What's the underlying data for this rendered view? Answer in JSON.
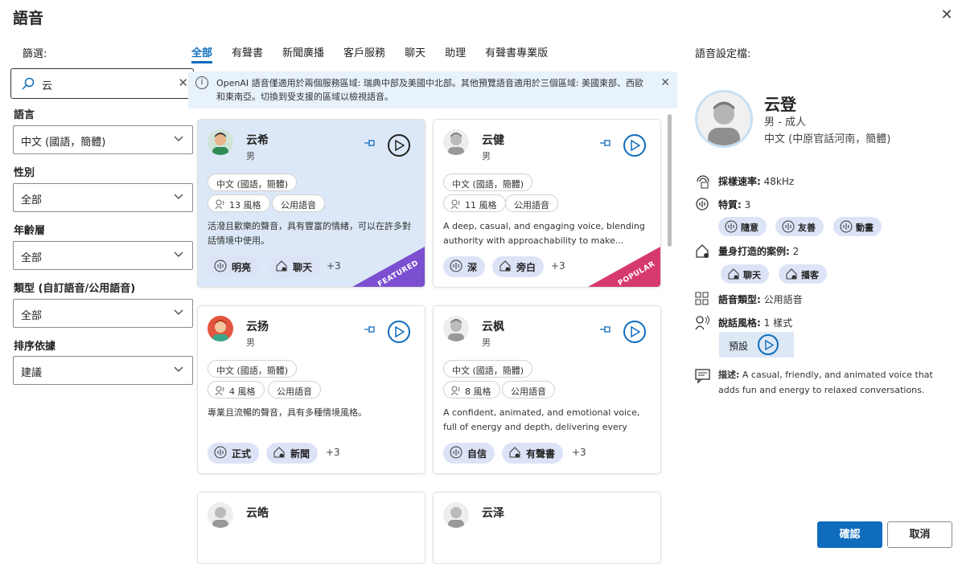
{
  "dialog": {
    "title": "語音"
  },
  "filters": {
    "label": "篩選:",
    "search_value": "云",
    "language": {
      "label": "語言",
      "value": "中文 (國語，簡體)"
    },
    "gender": {
      "label": "性別",
      "value": "全部"
    },
    "age": {
      "label": "年齡層",
      "value": "全部"
    },
    "type": {
      "label": "類型 (自訂語音/公用語音)",
      "value": "全部"
    },
    "sort": {
      "label": "排序依據",
      "value": "建議"
    }
  },
  "tabs": [
    "全部",
    "有聲書",
    "新聞廣播",
    "客戶服務",
    "聊天",
    "助理",
    "有聲書專業版"
  ],
  "banner": {
    "text": "OpenAI 語音僅適用於兩個服務區域: 瑞典中部及美國中北部。其他預覽語音適用於三個區域: 美國東部、西歐和東南亞。切換到受支援的區域以檢視語音。"
  },
  "cards": [
    {
      "name": "云希",
      "gender": "男",
      "lang": "中文 (國語，簡體)",
      "styles": "13 風格",
      "kind": "公用語音",
      "desc": "活潑且歡樂的聲音，具有豐富的情緒，可以在許多對話情境中使用。",
      "tag1": "明亮",
      "tag2": "聊天",
      "more": "+3",
      "ribbon": "FEATURED"
    },
    {
      "name": "云健",
      "gender": "男",
      "lang": "中文 (國語，簡體)",
      "styles": "11 風格",
      "kind": "公用語音",
      "desc": "A deep, casual, and engaging voice, blending authority with approachability to make...",
      "tag1": "深",
      "tag2": "旁白",
      "more": "+3",
      "ribbon": "POPULAR"
    },
    {
      "name": "云扬",
      "gender": "男",
      "lang": "中文 (國語，簡體)",
      "styles": "4 風格",
      "kind": "公用語音",
      "desc": "專業且流暢的聲音，具有多種情境風格。",
      "tag1": "正式",
      "tag2": "新聞",
      "more": "+3"
    },
    {
      "name": "云枫",
      "gender": "男",
      "lang": "中文 (國語，簡體)",
      "styles": "8 風格",
      "kind": "公用語音",
      "desc": "A confident, animated, and emotional voice, full of energy and depth, delivering every message...",
      "tag1": "自信",
      "tag2": "有聲書",
      "more": "+3"
    },
    {
      "name": "云皓"
    },
    {
      "name": "云泽"
    }
  ],
  "profile": {
    "label": "語音設定檔:",
    "name": "云登",
    "sub": "男 - 成人",
    "lang": "中文 (中原官話河南，簡體)",
    "sample_rate_label": "採樣速率:",
    "sample_rate": "48kHz",
    "traits_label": "特質:",
    "traits_count": "3",
    "traits": [
      "隨意",
      "友善",
      "動畫"
    ],
    "cases_label": "量身打造的案例:",
    "cases_count": "2",
    "cases": [
      "聊天",
      "播客"
    ],
    "type_label": "語音類型:",
    "type_value": "公用語音",
    "style_label": "說話風格:",
    "style_value": "1 樣式",
    "default_style": "預設",
    "desc_label": "描述:",
    "desc": "A casual, friendly, and animated voice that adds fun and energy to relaxed conversations."
  },
  "buttons": {
    "ok": "確認",
    "cancel": "取消"
  },
  "colors": {
    "accent": "#0f6cbd",
    "featured": "#7b4fd0",
    "popular": "#d63a6c",
    "tag_bg": "#dde3f7"
  }
}
